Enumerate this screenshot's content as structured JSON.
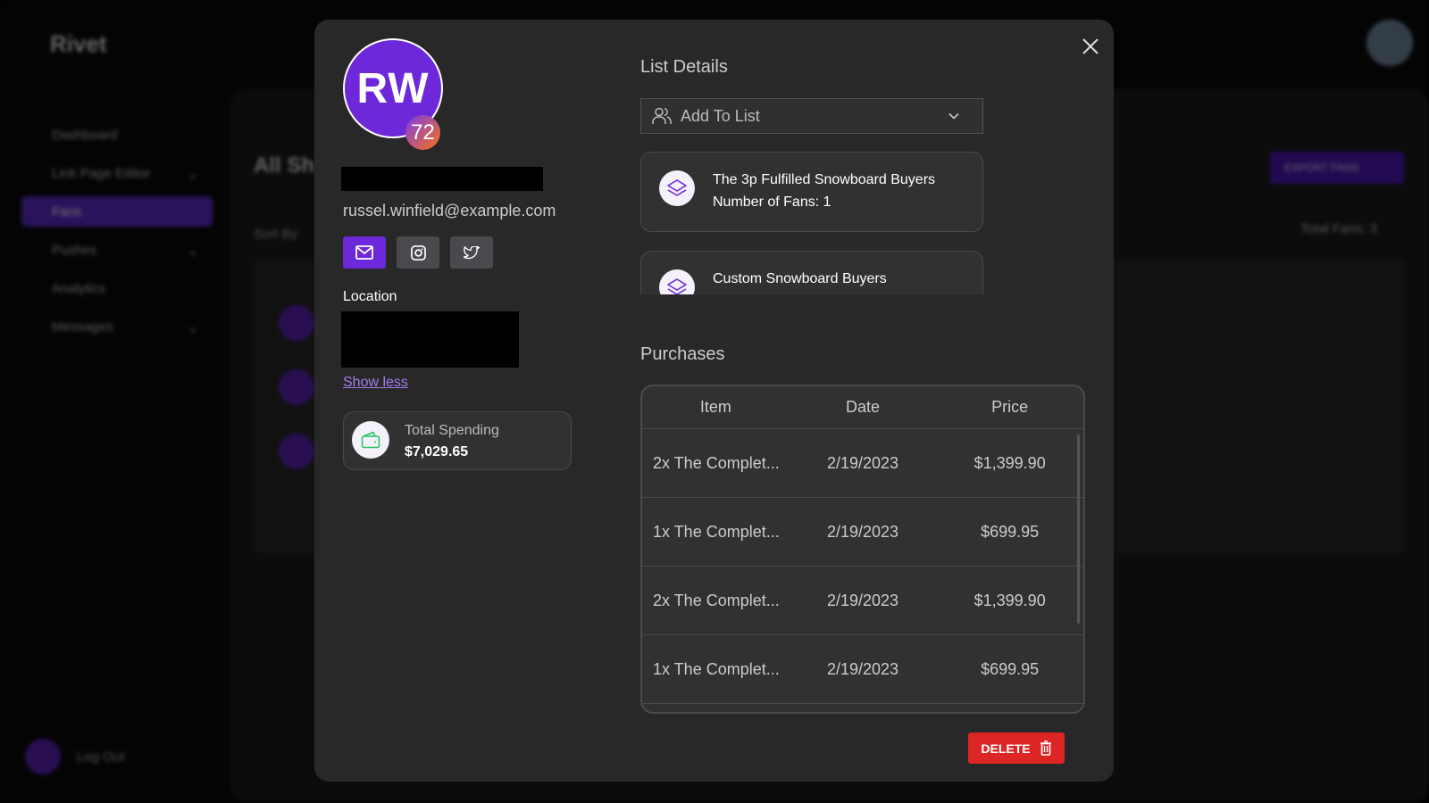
{
  "background": {
    "logo": "Rivet",
    "sidebar": [
      {
        "label": "Dashboard",
        "chevron": false
      },
      {
        "label": "Link Page Editor",
        "chevron": true
      },
      {
        "label": "Fans",
        "chevron": false,
        "active": true
      },
      {
        "label": "Pushes",
        "chevron": true
      },
      {
        "label": "Analytics",
        "chevron": false
      },
      {
        "label": "Messages",
        "chevron": true
      }
    ],
    "logout": "Log Out",
    "page_title": "All Sh",
    "sort_by": "Sort By",
    "export_button": "EXPORT FANS",
    "total_fans": "Total Fans: 3"
  },
  "modal": {
    "avatar_initials": "RW",
    "score": "72",
    "email": "russel.winfield@example.com",
    "social": [
      "mail-icon",
      "instagram-icon",
      "twitter-icon"
    ],
    "location_label": "Location",
    "show_less": "Show less",
    "total_spending_label": "Total Spending",
    "total_spending_value": "$7,029.65",
    "list_details_title": "List Details",
    "add_to_list": "Add To List",
    "lists": [
      {
        "name": "The 3p Fulfilled Snowboard Buyers",
        "count": "Number of Fans: 1"
      },
      {
        "name": "Custom Snowboard Buyers",
        "count": ""
      }
    ],
    "purchases_title": "Purchases",
    "table": {
      "headers": [
        "Item",
        "Date",
        "Price"
      ],
      "rows": [
        [
          "2x The Complet...",
          "2/19/2023",
          "$1,399.90"
        ],
        [
          "1x The Complet...",
          "2/19/2023",
          "$699.95"
        ],
        [
          "2x The Complet...",
          "2/19/2023",
          "$1,399.90"
        ],
        [
          "1x The Complet...",
          "2/19/2023",
          "$699.95"
        ]
      ]
    },
    "delete_label": "DELETE",
    "colors": {
      "accent": "#6d28d9",
      "danger": "#dc2626",
      "link": "#a47cf0"
    }
  }
}
